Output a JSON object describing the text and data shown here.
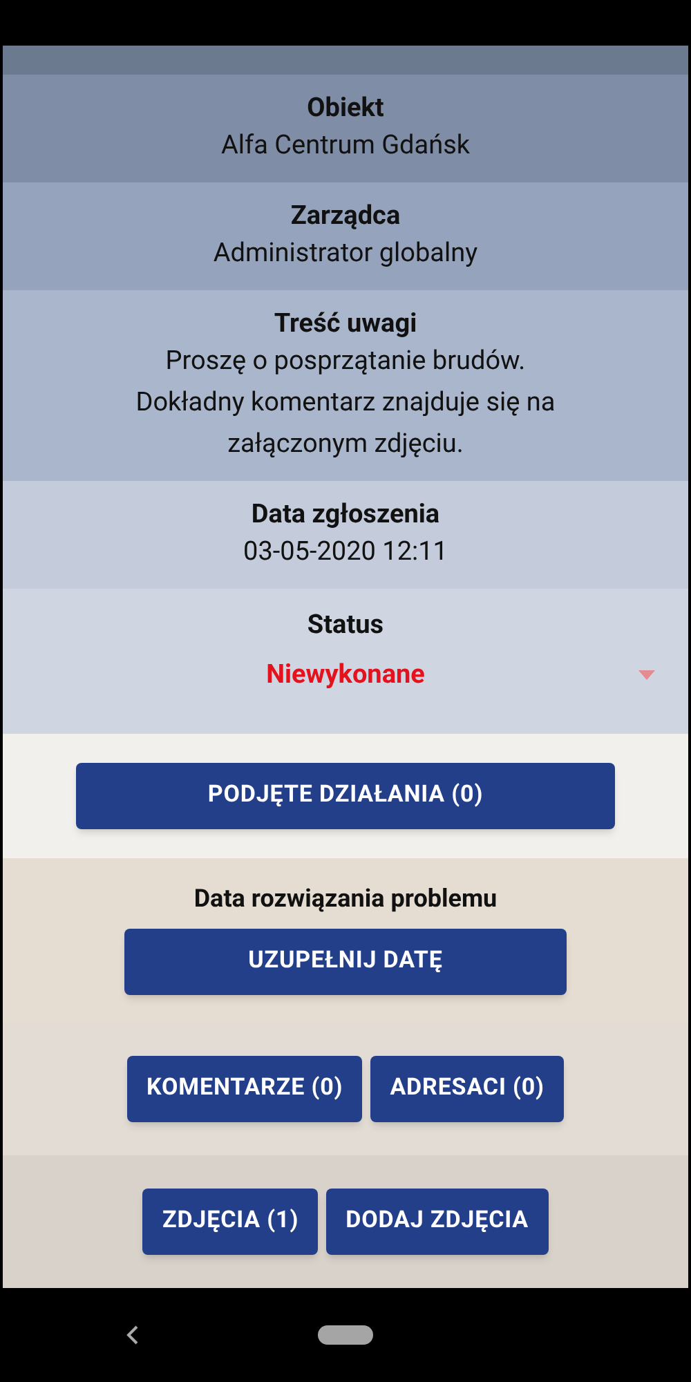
{
  "fields": [
    {
      "label": "Obiekt",
      "value": "Alfa Centrum Gdańsk"
    },
    {
      "label": "Zarządca",
      "value": "Administrator globalny"
    },
    {
      "label": "Treść uwagi",
      "value": "Proszę o posprzątanie brudów. Dokładny komentarz znajduje się na załączonym zdjęciu."
    },
    {
      "label": "Data zgłoszenia",
      "value": "03-05-2020 12:11"
    }
  ],
  "status": {
    "label": "Status",
    "value": "Niewykonane"
  },
  "actions_button": "PODJĘTE DZIAŁANIA (0)",
  "resolution": {
    "label": "Data rozwiązania problemu",
    "button": "UZUPEŁNIJ DATĘ"
  },
  "button_rows": [
    [
      "KOMENTARZE (0)",
      "ADRESACI (0)"
    ],
    [
      "ZDJĘCIA (1)",
      "DODAJ ZDJĘCIA"
    ]
  ]
}
